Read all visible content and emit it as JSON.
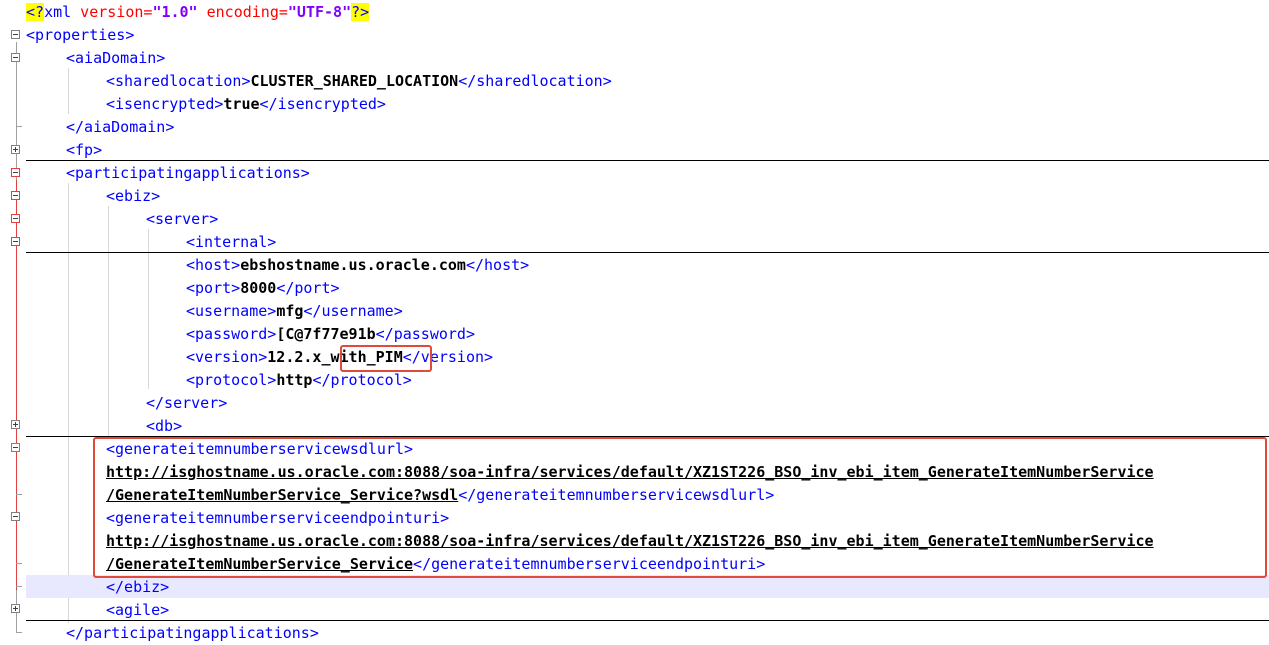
{
  "xml_decl": {
    "open": "<?",
    "name": "xml",
    "attr1_name": " version=",
    "attr1_value": "\"1.0\"",
    "attr2_name": " encoding=",
    "attr2_value": "\"UTF-8\"",
    "close": "?>"
  },
  "lines": {
    "l2": "<properties>",
    "l3": "<aiaDomain>",
    "l4_open": "<sharedlocation>",
    "l4_text": "CLUSTER_SHARED_LOCATION",
    "l4_close": "</sharedlocation>",
    "l5_open": "<isencrypted>",
    "l5_text": "true",
    "l5_close": "</isencrypted>",
    "l6": "</aiaDomain>",
    "l7": "<fp>",
    "l8": "<participatingapplications>",
    "l9": "<ebiz>",
    "l10": "<server>",
    "l11": "<internal>",
    "l12_open": "<host>",
    "l12_text": "ebshostname.us.oracle.com",
    "l12_close": "</host>",
    "l13_open": "<port>",
    "l13_text": "8000",
    "l13_close": "</port>",
    "l14_open": "<username>",
    "l14_text": "mfg",
    "l14_close": "</username>",
    "l15_open": "<password>",
    "l15_text": "[C@7f77e91b",
    "l15_close": "</password>",
    "l16_open": "<version>",
    "l16_text_a": "12.2.x",
    "l16_text_b": "_with_PIM",
    "l16_close": "</version>",
    "l17_open": "<protocol>",
    "l17_text": "http",
    "l17_close": "</protocol>",
    "l18": "</server>",
    "l19": "<db>",
    "l20": "<generateitemnumberservicewsdlurl>",
    "l21_url": "http://isghostname.us.oracle.com:8088/soa-infra/services/default/XZ1ST226_BSO_inv_ebi_item_GenerateItemNumberService",
    "l22_url": "/GenerateItemNumberService_Service?wsdl",
    "l22_close": "</generateitemnumberservicewsdlurl>",
    "l23": "<generateitemnumberserviceendpointuri>",
    "l24_url": "http://isghostname.us.oracle.com:8088/soa-infra/services/default/XZ1ST226_BSO_inv_ebi_item_GenerateItemNumberService",
    "l25_url": "/GenerateItemNumberService_Service",
    "l25_close": "</generateitemnumberserviceendpointuri>",
    "l26": "</ebiz>",
    "l27": "<agile>",
    "l28": "</participatingapplications>"
  },
  "colors": {
    "tag": "#0000ff",
    "text": "#000000",
    "highlight_box": "#e04a3a",
    "current_line": "#e8e8ff",
    "pi_background": "#ffff00"
  }
}
